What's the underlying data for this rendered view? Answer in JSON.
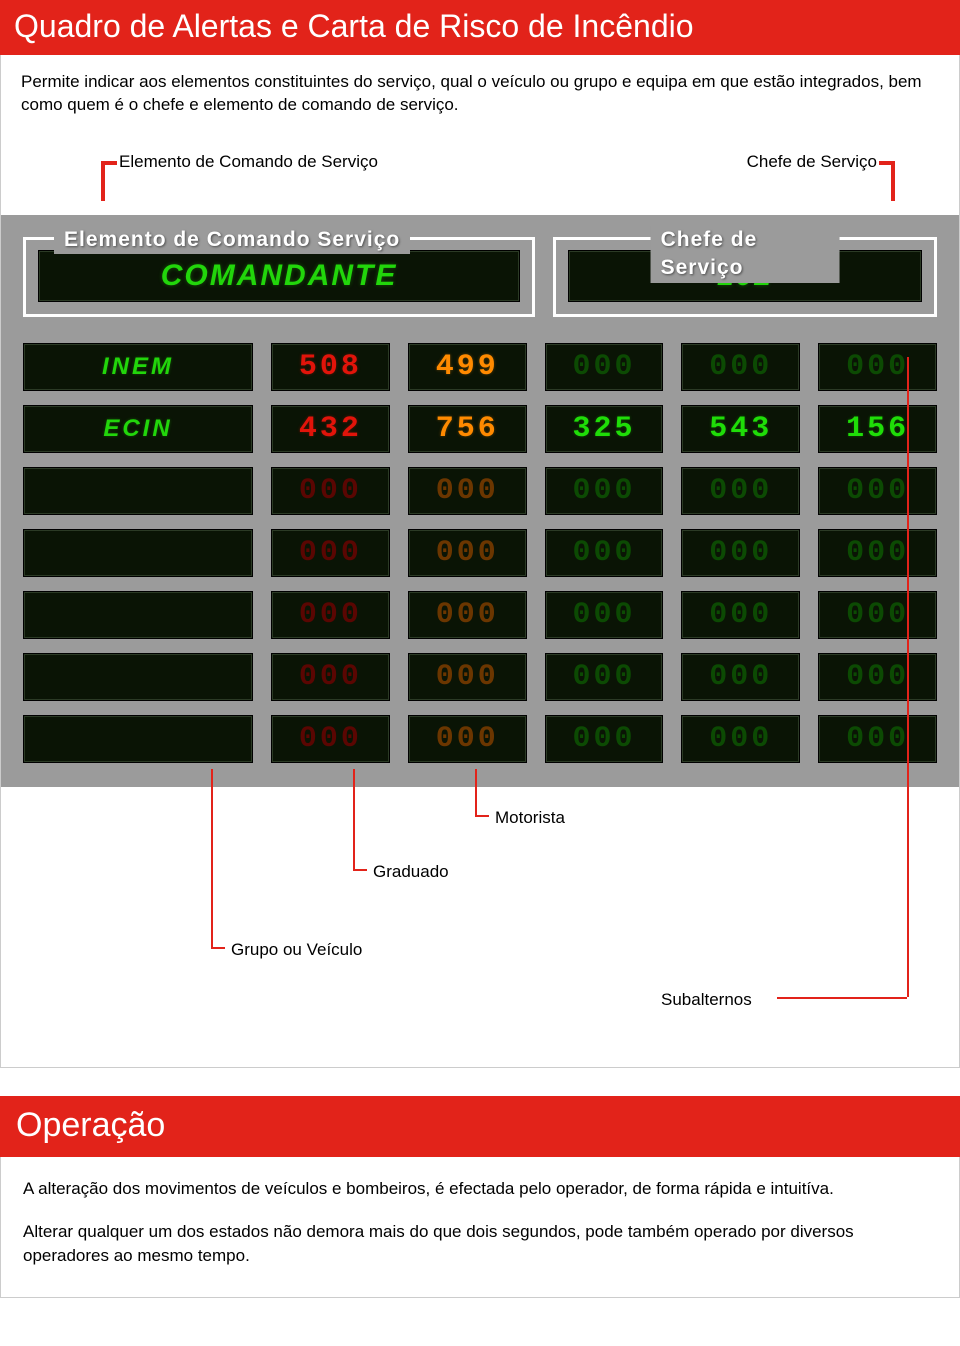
{
  "section1": {
    "title": "Quadro de Alertas e Carta de Risco de Incêndio",
    "intro": "Permite indicar aos elementos constituintes do serviço, qual o veículo ou grupo  e equipa em que estão integrados, bem como quem é o chefe e elemento de comando de serviço.",
    "callouts": {
      "top_left": "Elemento de Comando de Serviço",
      "top_right": "Chefe de Serviço",
      "motorista": "Motorista",
      "graduado": "Graduado",
      "grupo": "Grupo ou Veículo",
      "subalternos": "Subalternos"
    },
    "panel": {
      "legend_left": "Elemento de Comando Serviço",
      "legend_right": "Chefe de Serviço",
      "value_left": "COMANDANTE",
      "value_right": "102",
      "rows": [
        {
          "label": "INEM",
          "cells": [
            {
              "v": "508",
              "c": "red"
            },
            {
              "v": "499",
              "c": "orange"
            },
            {
              "v": "000",
              "c": "green",
              "dim": true
            },
            {
              "v": "000",
              "c": "green",
              "dim": true
            },
            {
              "v": "000",
              "c": "green",
              "dim": true
            }
          ]
        },
        {
          "label": "ECIN",
          "cells": [
            {
              "v": "432",
              "c": "red"
            },
            {
              "v": "756",
              "c": "orange"
            },
            {
              "v": "325",
              "c": "green"
            },
            {
              "v": "543",
              "c": "green"
            },
            {
              "v": "156",
              "c": "green"
            }
          ]
        },
        {
          "label": "",
          "cells": [
            {
              "v": "000",
              "c": "red",
              "dim": true
            },
            {
              "v": "000",
              "c": "orange",
              "dim": true
            },
            {
              "v": "000",
              "c": "green",
              "dim": true
            },
            {
              "v": "000",
              "c": "green",
              "dim": true
            },
            {
              "v": "000",
              "c": "green",
              "dim": true
            }
          ]
        },
        {
          "label": "",
          "cells": [
            {
              "v": "000",
              "c": "red",
              "dim": true
            },
            {
              "v": "000",
              "c": "orange",
              "dim": true
            },
            {
              "v": "000",
              "c": "green",
              "dim": true
            },
            {
              "v": "000",
              "c": "green",
              "dim": true
            },
            {
              "v": "000",
              "c": "green",
              "dim": true
            }
          ]
        },
        {
          "label": "",
          "cells": [
            {
              "v": "000",
              "c": "red",
              "dim": true
            },
            {
              "v": "000",
              "c": "orange",
              "dim": true
            },
            {
              "v": "000",
              "c": "green",
              "dim": true
            },
            {
              "v": "000",
              "c": "green",
              "dim": true
            },
            {
              "v": "000",
              "c": "green",
              "dim": true
            }
          ]
        },
        {
          "label": "",
          "cells": [
            {
              "v": "000",
              "c": "red",
              "dim": true
            },
            {
              "v": "000",
              "c": "orange",
              "dim": true
            },
            {
              "v": "000",
              "c": "green",
              "dim": true
            },
            {
              "v": "000",
              "c": "green",
              "dim": true
            },
            {
              "v": "000",
              "c": "green",
              "dim": true
            }
          ]
        },
        {
          "label": "",
          "cells": [
            {
              "v": "000",
              "c": "red",
              "dim": true
            },
            {
              "v": "000",
              "c": "orange",
              "dim": true
            },
            {
              "v": "000",
              "c": "green",
              "dim": true
            },
            {
              "v": "000",
              "c": "green",
              "dim": true
            },
            {
              "v": "000",
              "c": "green",
              "dim": true
            }
          ]
        }
      ]
    }
  },
  "section2": {
    "title": "Operação",
    "p1": "A alteração dos movimentos de veículos e bombeiros, é efectada pelo operador, de forma rápida e intuitíva.",
    "p2": "Alterar qualquer um dos estados não demora mais do que dois segundos, pode também operado por diversos operadores ao mesmo tempo."
  },
  "colors": {
    "red": "#e2231a",
    "led_green": "#22d60b",
    "led_red": "#e1140a",
    "led_orange": "#ff8a00",
    "panel_bg": "#9b9b9b"
  }
}
